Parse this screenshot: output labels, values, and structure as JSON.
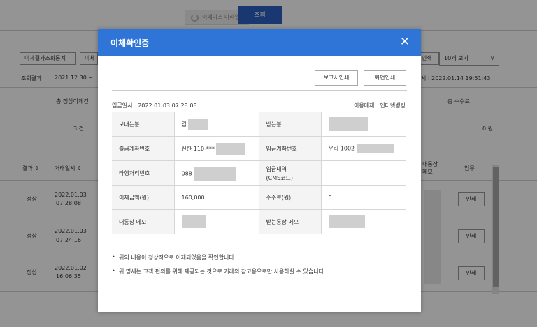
{
  "background": {
    "search_chip": "이페이스 마라일",
    "query_button": "조회",
    "toolbar_buttons": [
      "이체결과조회통계",
      "이체"
    ],
    "right_button": "인쇄",
    "page_size": "10개 보기",
    "result_label": "조회결과",
    "result_range": "2021.12.30 ~",
    "result_time": "시 : 2022.01.14 19:51:43",
    "summary_heads": [
      "총 정상이체건",
      "총 수수료"
    ],
    "summary_vals": [
      "3 건",
      "0 원"
    ],
    "table_headers": [
      "결과 ⇕",
      "거래일시 ⇕",
      "내통장\n메모",
      "업무"
    ],
    "rows": [
      {
        "result": "정상",
        "date": "2022.01.03",
        "time": "07:28:08",
        "action": "인쇄"
      },
      {
        "result": "정상",
        "date": "2022.01.03",
        "time": "07:24:16",
        "action": "인쇄"
      },
      {
        "result": "정상",
        "date": "2022.01.02",
        "time": "16:06:35",
        "action": "인쇄"
      }
    ]
  },
  "modal": {
    "title": "이체확인증",
    "close_icon": "close-icon",
    "buttons": {
      "report_print": "보고서인쇄",
      "screen_print": "화면인쇄"
    },
    "deposit_datetime": "입금일시 : 2022.01.03 07:28:08",
    "channel": "이용매체 : 인터넷뱅킹",
    "rows": [
      {
        "label_a": "보내는분",
        "value_a": "김",
        "label_b": "받는분",
        "value_b": ""
      },
      {
        "label_a": "출금계좌번호",
        "value_a": "신한 110-***",
        "label_b": "입금계좌번호",
        "value_b": "우리 1002"
      },
      {
        "label_a": "타행처리번호",
        "value_a": "088",
        "label_b": "입금내역\n(CMS코드)",
        "value_b": ""
      },
      {
        "label_a": "이체금액(원)",
        "value_a": "160,000",
        "label_b": "수수료(원)",
        "value_b": "0"
      },
      {
        "label_a": "내통장 메모",
        "value_a": "",
        "label_b": "받는통장 메모",
        "value_b": ""
      }
    ],
    "notes": [
      "위의 내용이 정상적으로 이체되었음을 확인합니다.",
      "위 명세는 고객 편의를 위해 제공되는 것으로 거래의 참고용으로만 사용하실 수 있습니다."
    ]
  }
}
